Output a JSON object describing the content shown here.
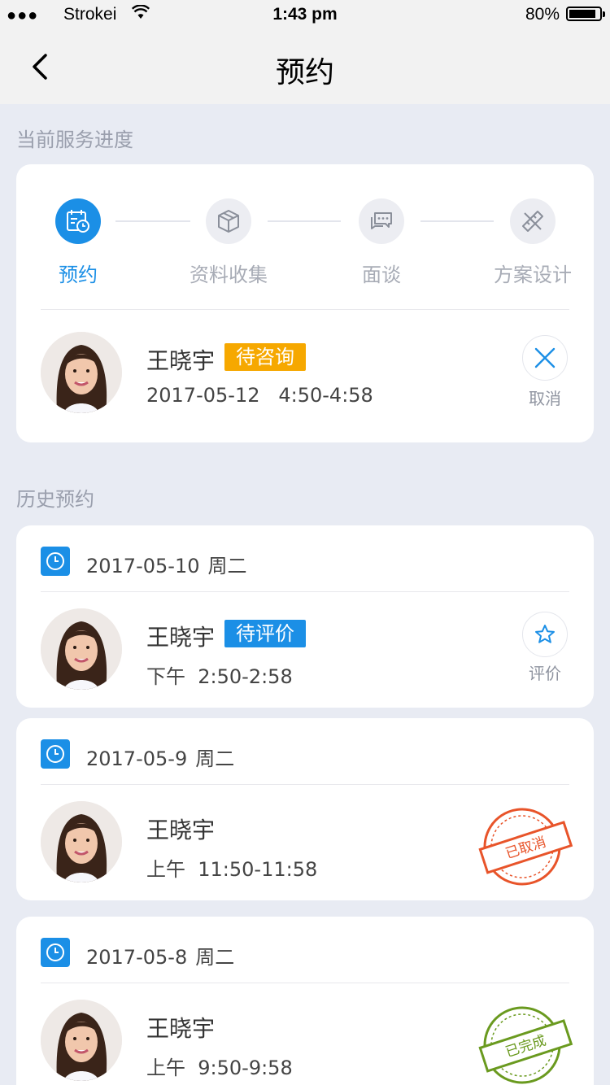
{
  "status_bar": {
    "signal": "●●●",
    "carrier": "Strokei",
    "time": "1:43 pm",
    "battery_pct": "80%",
    "battery_level": 0.8
  },
  "nav": {
    "title": "预约",
    "back_icon": "chevron-left-icon"
  },
  "current": {
    "section_label": "当前服务进度",
    "steps": [
      {
        "label": "预约",
        "icon": "calendar-clock-icon",
        "active": true
      },
      {
        "label": "资料收集",
        "icon": "box-icon",
        "active": false
      },
      {
        "label": "面谈",
        "icon": "chat-bubbles-icon",
        "active": false
      },
      {
        "label": "方案设计",
        "icon": "ruler-pencil-icon",
        "active": false
      }
    ],
    "appointment": {
      "name": "王晓宇",
      "status": "待咨询",
      "date": "2017-05-12",
      "time": "4:50-4:58",
      "action_label": "取消"
    }
  },
  "history": {
    "section_label": "历史预约",
    "items": [
      {
        "date": "2017-05-10",
        "weekday": "周二",
        "name": "王晓宇",
        "status": "待评价",
        "period": "下午",
        "time": "2:50-2:58",
        "action_label": "评价"
      },
      {
        "date": "2017-05-9",
        "weekday": "周二",
        "name": "王晓宇",
        "period": "上午",
        "time": "11:50-11:58",
        "stamp": "已取消",
        "stamp_color": "#e8542a"
      },
      {
        "date": "2017-05-8",
        "weekday": "周二",
        "name": "王晓宇",
        "period": "上午",
        "time": "9:50-9:58",
        "stamp": "已完成",
        "stamp_color": "#6a9a1f"
      }
    ]
  },
  "colors": {
    "accent": "#1b8fe6",
    "orange": "#f6a800",
    "background": "#e8ebf3"
  }
}
